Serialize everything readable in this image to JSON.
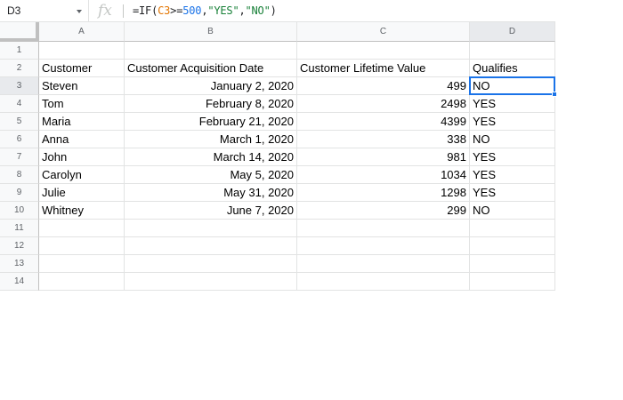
{
  "name_box": {
    "value": "D3"
  },
  "formula": {
    "prefix": "=IF(",
    "ref": "C3",
    "op": ">=",
    "num": "500",
    "comma1": ",",
    "str_yes": "\"YES\"",
    "comma2": ",",
    "str_no": "\"NO\"",
    "suffix": ")"
  },
  "fx_label": "fx",
  "columns": [
    "A",
    "B",
    "C",
    "D"
  ],
  "rows": [
    "1",
    "2",
    "3",
    "4",
    "5",
    "6",
    "7",
    "8",
    "9",
    "10",
    "11",
    "12",
    "13",
    "14"
  ],
  "headers": [
    "Customer",
    "Customer Acquisition Date",
    "Customer Lifetime Value",
    "Qualifies"
  ],
  "records": [
    [
      "Steven",
      "January 2, 2020",
      "499",
      "NO"
    ],
    [
      "Tom",
      "February 8, 2020",
      "2498",
      "YES"
    ],
    [
      "Maria",
      "February 21, 2020",
      "4399",
      "YES"
    ],
    [
      "Anna",
      "March 1, 2020",
      "338",
      "NO"
    ],
    [
      "John",
      "March 14, 2020",
      "981",
      "YES"
    ],
    [
      "Carolyn",
      "May 5, 2020",
      "1034",
      "YES"
    ],
    [
      "Julie",
      "May 31, 2020",
      "1298",
      "YES"
    ],
    [
      "Whitney",
      "June 7, 2020",
      "299",
      "NO"
    ]
  ],
  "selection": {
    "cell": "D3"
  },
  "colors": {
    "selection": "#1a73e8",
    "header_bg": "#f8f9fa",
    "gridline": "#e2e3e3"
  }
}
